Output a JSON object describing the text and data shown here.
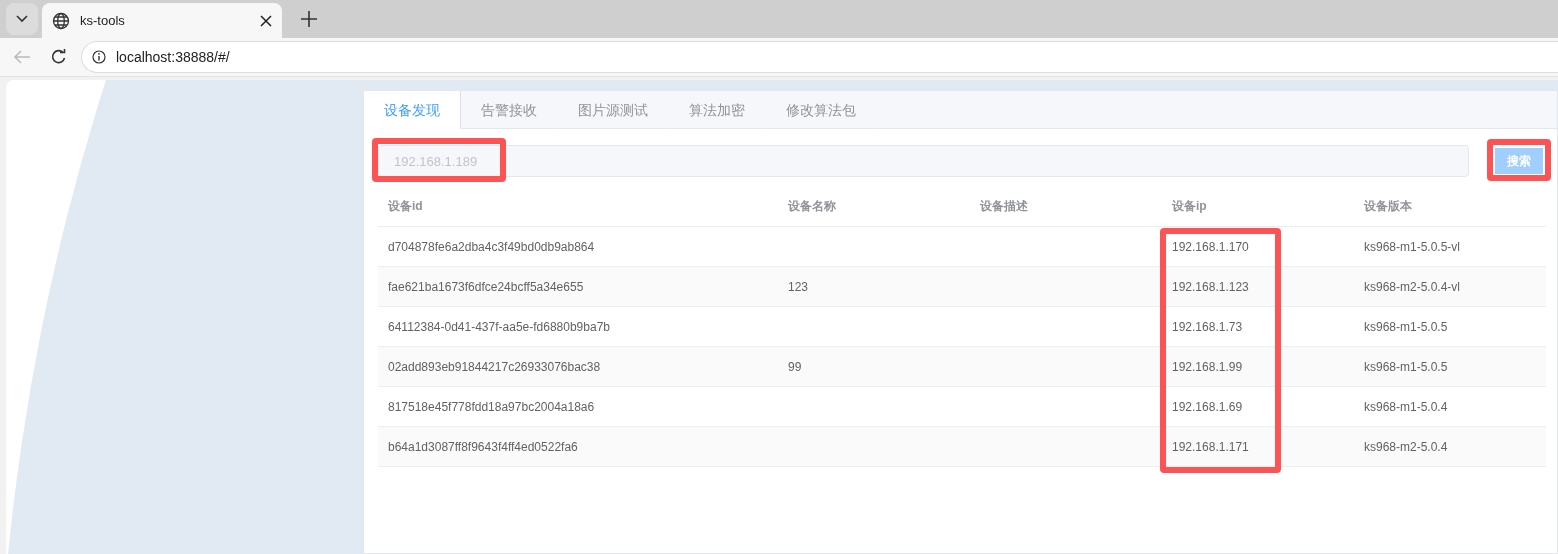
{
  "browser": {
    "tab_title": "ks-tools",
    "address": "localhost:38888/#/"
  },
  "tabs": [
    {
      "label": "设备发现",
      "selected": true
    },
    {
      "label": "告警接收",
      "selected": false
    },
    {
      "label": "图片源测试",
      "selected": false
    },
    {
      "label": "算法加密",
      "selected": false
    },
    {
      "label": "修改算法包",
      "selected": false
    }
  ],
  "search": {
    "placeholder": "192.168.1.189",
    "highlighted": true,
    "button": "搜索",
    "button_highlighted": true
  },
  "table": {
    "columns": [
      {
        "label": "设备id",
        "highlighted": false
      },
      {
        "label": "设备名称",
        "highlighted": false
      },
      {
        "label": "设备描述",
        "highlighted": false
      },
      {
        "label": "设备ip",
        "highlighted": true
      },
      {
        "label": "设备版本",
        "highlighted": false
      }
    ],
    "rows": [
      [
        "d704878fe6a2dba4c3f49bd0db9ab864",
        "",
        "",
        "192.168.1.170",
        "ks968-m1-5.0.5-vl"
      ],
      [
        "fae621ba1673f6dfce24bcff5a34e655",
        "123",
        "",
        "192.168.1.123",
        "ks968-m2-5.0.4-vl"
      ],
      [
        "64112384-0d41-437f-aa5e-fd6880b9ba7b",
        "",
        "",
        "192.168.1.73",
        "ks968-m1-5.0.5"
      ],
      [
        "02add893eb91844217c26933076bac38",
        "99",
        "",
        "192.168.1.99",
        "ks968-m1-5.0.5"
      ],
      [
        "817518e45f778fdd18a97bc2004a18a6",
        "",
        "",
        "192.168.1.69",
        "ks968-m1-5.0.4"
      ],
      [
        "b64a1d3087ff8f9643f4ff4ed0522fa6",
        "",
        "",
        "192.168.1.171",
        "ks968-m2-5.0.4"
      ]
    ]
  }
}
